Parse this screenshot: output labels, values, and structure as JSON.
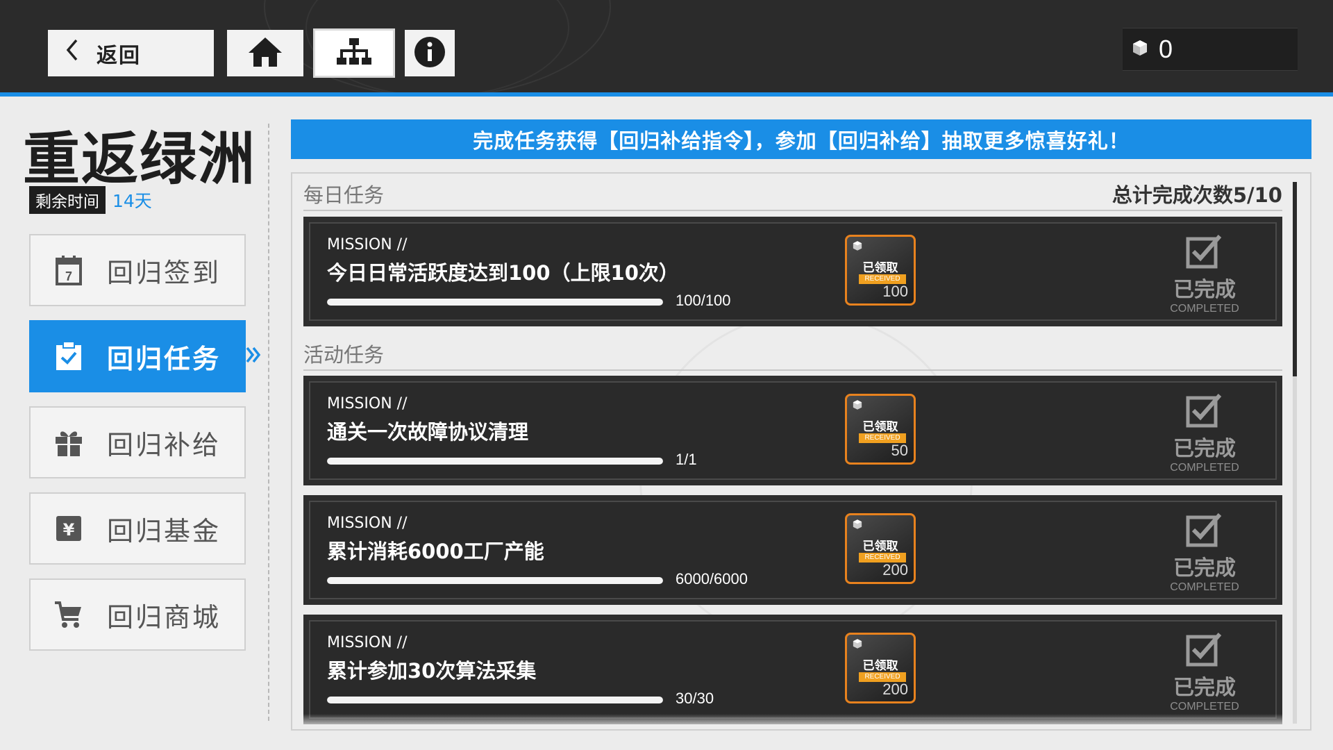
{
  "header": {
    "back_label": "返回",
    "currency_value": "0"
  },
  "event": {
    "title": "重返绿洲",
    "time_tag": "剩余时间",
    "time_left": "14天"
  },
  "nav": {
    "items": [
      {
        "label": "回归签到",
        "icon": "calendar-icon"
      },
      {
        "label": "回归任务",
        "icon": "clipboard-check-icon",
        "active": true
      },
      {
        "label": "回归补给",
        "icon": "gift-icon"
      },
      {
        "label": "回归基金",
        "icon": "yen-icon"
      },
      {
        "label": "回归商城",
        "icon": "cart-icon"
      }
    ]
  },
  "banner": "完成任务获得【回归补给指令】，参加【回归补给】抽取更多惊喜好礼！",
  "daily": {
    "title": "每日任务",
    "total": "总计完成次数5/10"
  },
  "activity": {
    "title": "活动任务"
  },
  "common": {
    "mission_label": "MISSION //",
    "received_cn": "已领取",
    "received_en": "RECEIVED",
    "completed_cn": "已完成",
    "completed_en": "COMPLETED"
  },
  "missions": [
    {
      "title": "今日日常活跃度达到100（上限10次）",
      "progress_text": "100/100",
      "progress": 1.0,
      "reward": "100"
    },
    {
      "title": "通关一次故障协议清理",
      "progress_text": "1/1",
      "progress": 1.0,
      "reward": "50"
    },
    {
      "title": "累计消耗6000工厂产能",
      "progress_text": "6000/6000",
      "progress": 1.0,
      "reward": "200"
    },
    {
      "title": "累计参加30次算法采集",
      "progress_text": "30/30",
      "progress": 1.0,
      "reward": "200"
    }
  ],
  "colors": {
    "accent": "#1a8ee6",
    "reward_border": "#e8821e",
    "received_tag": "#f0a020"
  }
}
